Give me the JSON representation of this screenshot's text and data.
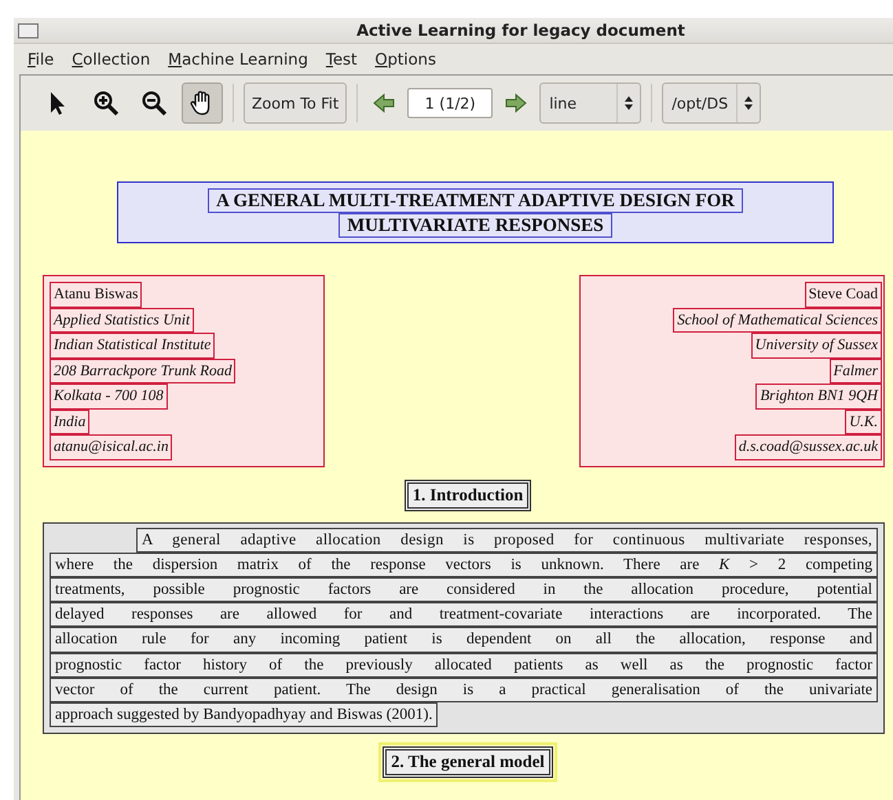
{
  "window": {
    "title": "Active Learning for legacy document"
  },
  "menu": [
    "File",
    "Collection",
    "Machine Learning",
    "Test",
    "Options"
  ],
  "toolbar": {
    "tools": [
      {
        "kind": "select",
        "selected": false
      },
      {
        "kind": "zoom-in",
        "selected": false
      },
      {
        "kind": "zoom-out",
        "selected": false
      },
      {
        "kind": "pan",
        "selected": true
      }
    ],
    "zoom_button": "Zoom To Fit",
    "page": "1 (1/2)",
    "mode": "line",
    "path": "/opt/DS"
  },
  "document": {
    "title": {
      "lines": [
        "A GENERAL MULTI-TREATMENT ADAPTIVE DESIGN FOR",
        "MULTIVARIATE RESPONSES"
      ]
    },
    "authors": [
      {
        "lines": [
          {
            "text": "Atanu Biswas",
            "italic": false
          },
          {
            "text": "Applied Statistics Unit",
            "italic": true
          },
          {
            "text": "Indian Statistical Institute",
            "italic": true
          },
          {
            "text": "208 Barrackpore Trunk Road",
            "italic": true
          },
          {
            "text": "Kolkata - 700 108",
            "italic": true
          },
          {
            "text": "India",
            "italic": true
          },
          {
            "text": "atanu@isical.ac.in",
            "italic": true
          }
        ]
      },
      {
        "lines": [
          {
            "text": "Steve Coad",
            "italic": false
          },
          {
            "text": "School of Mathematical Sciences",
            "italic": true
          },
          {
            "text": "University of Sussex",
            "italic": true
          },
          {
            "text": "Falmer",
            "italic": true
          },
          {
            "text": "Brighton BN1 9QH",
            "italic": true
          },
          {
            "text": "U.K.",
            "italic": true
          },
          {
            "text": "d.s.coad@sussex.ac.uk",
            "italic": true
          }
        ]
      }
    ],
    "heading_1": "1. Introduction",
    "paragraph": {
      "lines": [
        "A general adaptive allocation design is proposed for continuous multivariate responses,",
        "where the dispersion matrix of the response vectors is unknown. There are *K* > 2 competing",
        "treatments, possible prognostic factors are considered in the allocation procedure, potential",
        "delayed responses are allowed for and treatment-covariate interactions are incorporated. The",
        "allocation rule for any incoming patient is dependent on all the allocation, response and",
        "prognostic factor history of the previously allocated patients as well as the prognostic factor",
        "vector of the current patient. The design is a practical generalisation of the univariate",
        "approach suggested by Bandyopadhyay and Biswas (2001)."
      ]
    },
    "heading_2": "2. The general model"
  }
}
